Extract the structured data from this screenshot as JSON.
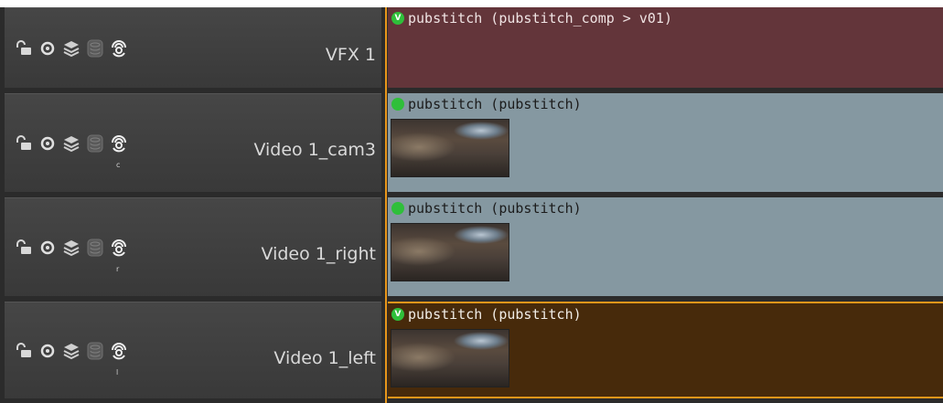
{
  "colors": {
    "vfx_clip": "#63353a",
    "video_clip": "#8598a1",
    "selected_clip": "#472a0b",
    "selection_border": "#e8961a",
    "status_green": "#2fbf3a",
    "panel_bg": "#2b2b2b"
  },
  "tracks": [
    {
      "name": "VFX 1",
      "sub": "",
      "clip": {
        "title": "pubstitch (pubstitch_comp > v01)",
        "status": "V",
        "thumbnail": false
      }
    },
    {
      "name": "Video 1_cam3",
      "sub": "c",
      "clip": {
        "title": "pubstitch (pubstitch)",
        "status": "",
        "thumbnail": true
      }
    },
    {
      "name": "Video 1_right",
      "sub": "r",
      "clip": {
        "title": "pubstitch (pubstitch)",
        "status": "",
        "thumbnail": true
      }
    },
    {
      "name": "Video 1_left",
      "sub": "l",
      "clip": {
        "title": "pubstitch (pubstitch)",
        "status": "V",
        "thumbnail": true
      }
    }
  ],
  "icons": [
    "lock-icon",
    "eye-icon",
    "layers-icon",
    "database-icon",
    "audio-target-icon"
  ]
}
